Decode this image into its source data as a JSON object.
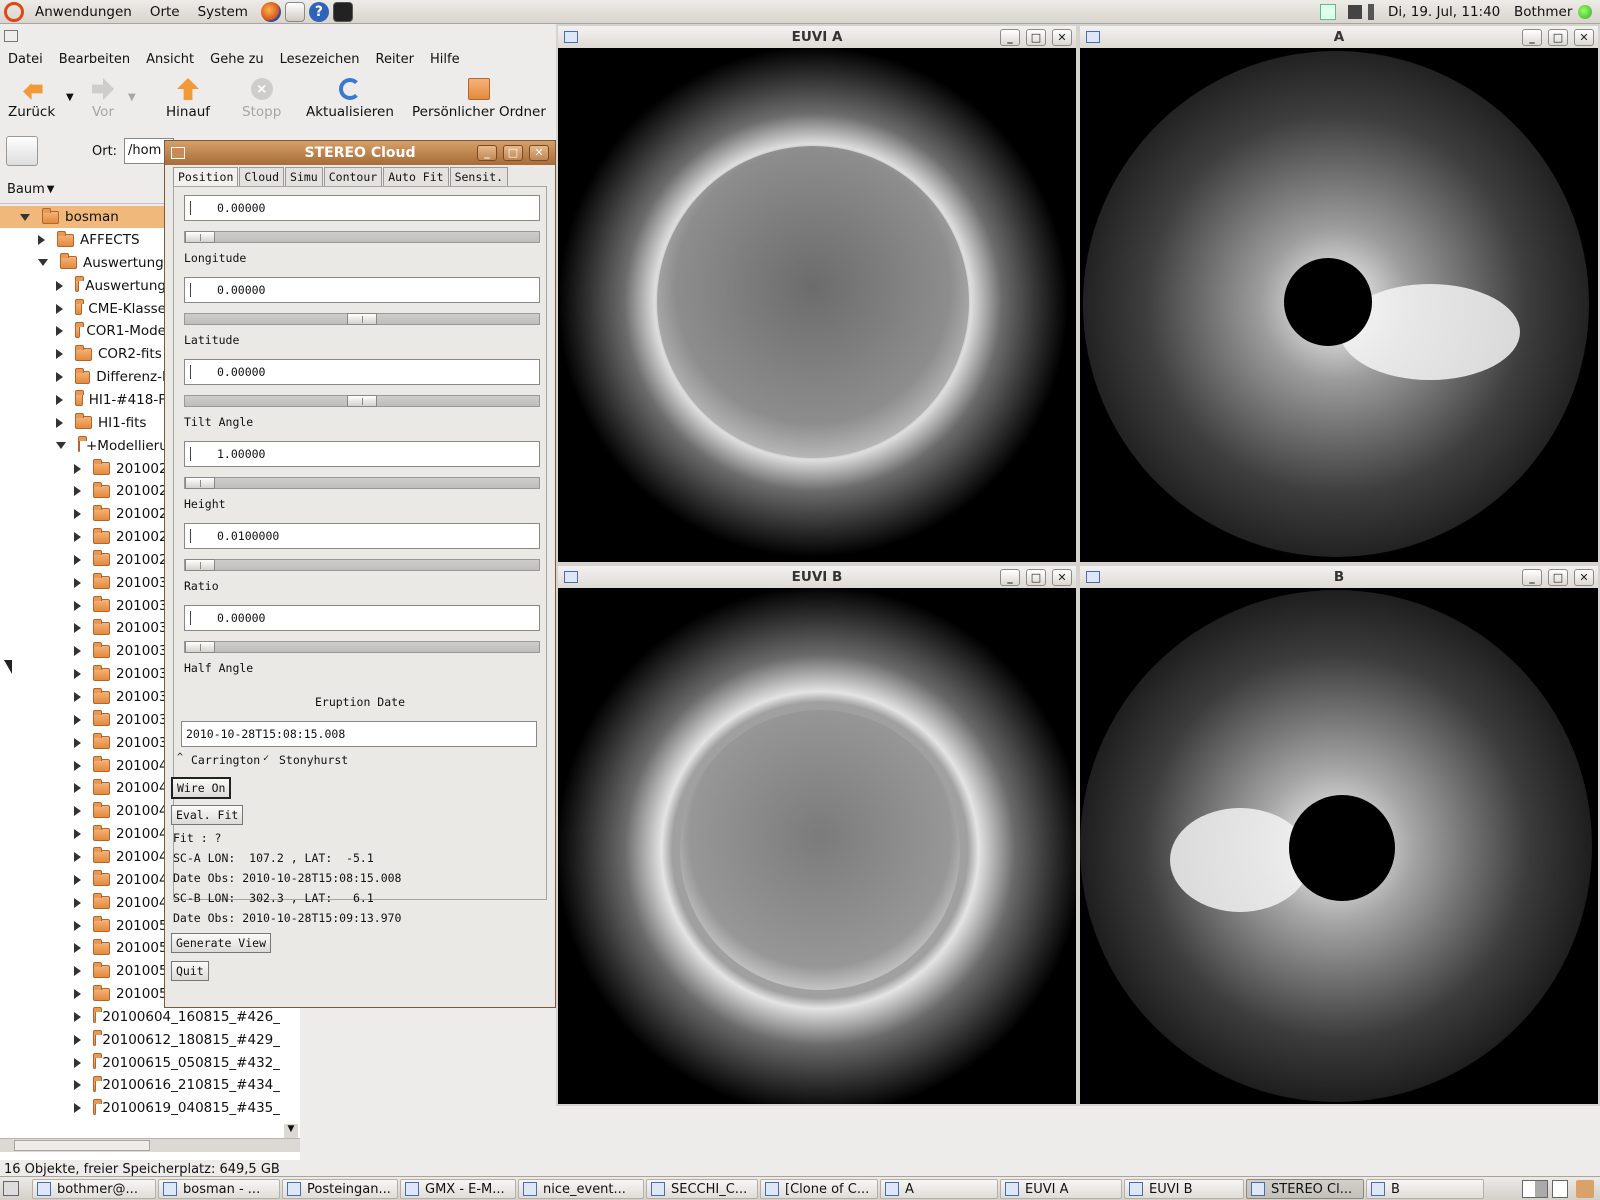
{
  "top_panel": {
    "apps": "Anwendungen",
    "places": "Orte",
    "system": "System",
    "datetime": "Di, 19. Jul, 11:40",
    "user": "Bothmer"
  },
  "nautilus": {
    "menu": [
      "Datei",
      "Bearbeiten",
      "Ansicht",
      "Gehe zu",
      "Lesezeichen",
      "Reiter",
      "Hilfe"
    ],
    "toolbar": {
      "back": "Zurück",
      "forward": "Vor",
      "up": "Hinauf",
      "stop": "Stopp",
      "reload": "Aktualisieren",
      "home": "Persönlicher Ordner"
    },
    "location_label": "Ort:",
    "location_value": "/hom",
    "view_mode": "Baum",
    "tree": {
      "root": "bosman",
      "level1": [
        "AFFECTS",
        "Auswertung"
      ],
      "level2": [
        "Auswertung",
        "CME-Klasse",
        "COR1-Mode",
        "COR2-fits",
        "Differenz-I",
        "HI1-#418-F",
        "HI1-fits",
        "+Modellieru"
      ],
      "level3": [
        "201002",
        "201002",
        "201002",
        "201002",
        "201002",
        "201003",
        "201003",
        "201003",
        "201003",
        "201003",
        "201003",
        "201003",
        "201003",
        "201004",
        "201004",
        "201004",
        "201004",
        "201004",
        "201004",
        "201004",
        "201005",
        "201005",
        "201005",
        "201005"
      ],
      "level3_full": [
        "20100604_160815_#426_",
        "20100612_180815_#429_",
        "20100615_050815_#432_",
        "20100616_210815_#434_",
        "20100619_040815_#435_"
      ]
    },
    "status": "16 Objekte, freier Speicherplatz: 649,5 GB"
  },
  "windows": {
    "euvi_a": "EUVI A",
    "cor_a": "A",
    "euvi_b": "EUVI B",
    "cor_b": "B"
  },
  "stereo": {
    "title": "STEREO Cloud",
    "tabs": [
      "Position",
      "Cloud",
      "Simu",
      "Contour",
      "Auto Fit",
      "Sensit."
    ],
    "params": [
      {
        "label": "Longitude",
        "value": "0.00000",
        "slider": 0.0
      },
      {
        "label": "Latitude",
        "value": "0.00000",
        "slider": 0.5
      },
      {
        "label": "Tilt Angle",
        "value": "0.00000",
        "slider": 0.5
      },
      {
        "label": "Height",
        "value": "1.00000",
        "slider": 0.0
      },
      {
        "label": "Ratio",
        "value": "0.0100000",
        "slider": 0.0
      },
      {
        "label": "Half Angle",
        "value": "0.00000",
        "slider": 0.0
      }
    ],
    "eruption_label": "Eruption Date",
    "eruption_value": "2010-10-28T15:08:15.008",
    "radio_carrington": "Carrington",
    "radio_stonyhurst": "Stonyhurst",
    "wire_btn": "Wire On",
    "eval_btn": "Eval. Fit",
    "fit": "Fit : ?",
    "sca": "SC-A LON:  107.2 , LAT:  -5.1",
    "date_a": "Date Obs: 2010-10-28T15:08:15.008",
    "scb": "SC-B LON:  302.3 , LAT:   6.1",
    "date_b": "Date Obs: 2010-10-28T15:09:13.970",
    "generate_btn": "Generate View",
    "quit_btn": "Quit"
  },
  "taskbar": [
    "bothmer@...",
    "bosman - ...",
    "Posteingan...",
    "GMX - E-M...",
    "nice_event...",
    "SECCHI_C...",
    "[Clone of C...",
    "A",
    "EUVI A",
    "EUVI B",
    "STEREO Cl...",
    "B"
  ]
}
